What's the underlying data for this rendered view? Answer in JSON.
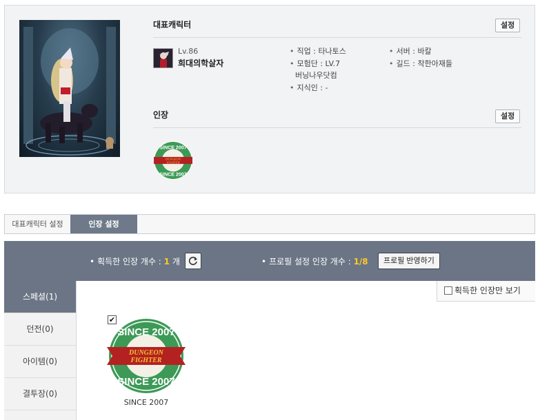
{
  "profile": {
    "rep_title": "대표캐릭터",
    "set_label": "설정",
    "level": "Lv.86",
    "name": "희대의학살자",
    "job": "직업 : 타나토스",
    "adventure": "모험단 : LV.7",
    "adventure_name": "버닝나우닷컴",
    "knowledge": "지식인 : -",
    "server": "서버 : 바칼",
    "guild": "길드 : 착한아재들",
    "stamp_title": "인장",
    "stamp_set_label": "설정"
  },
  "stamp_text": {
    "top": "SINCE 2007",
    "bottom": "SINCE 2007",
    "logo_top": "DUNGEON",
    "logo_bottom": "FIGHTER"
  },
  "tabs": [
    {
      "label": "대표캐릭터 설정"
    },
    {
      "label": "인장 설정"
    }
  ],
  "count_bar": {
    "acquired_prefix": "획득한 인장 개수 : ",
    "acquired_count": "1",
    "acquired_unit": " 개",
    "profile_prefix": "프로필 설정 인장 개수 : ",
    "profile_count": "1/8",
    "apply_label": "프로필 반영하기"
  },
  "categories": [
    {
      "label": "스페셜(1)"
    },
    {
      "label": "던전(0)"
    },
    {
      "label": "아이템(0)"
    },
    {
      "label": "결투장(0)"
    }
  ],
  "filter_label": "획득한 인장만 보기",
  "stamp_item": {
    "label": "SINCE 2007",
    "check": "✔"
  },
  "colors": {
    "accent_bar": "#6b7585",
    "count_highlight": "#ffc928",
    "stamp_green": "#3c9a56",
    "stamp_red": "#b42121"
  }
}
